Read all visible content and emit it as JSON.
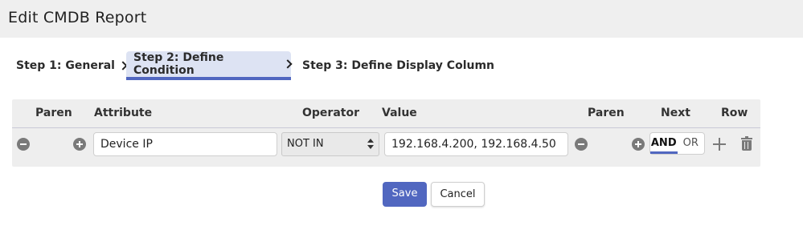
{
  "header": {
    "title": "Edit CMDB Report"
  },
  "steps": [
    {
      "label": "Step 1: General"
    },
    {
      "label": "Step 2: Define Condition",
      "active": true
    },
    {
      "label": "Step 3: Define Display Column"
    }
  ],
  "table": {
    "columns": [
      "Paren",
      "Attribute",
      "Operator",
      "Value",
      "Paren",
      "Next",
      "Row"
    ],
    "rows": [
      {
        "attribute": "Device IP",
        "operator": "NOT IN",
        "value": "192.168.4.200, 192.168.4.50",
        "next_options": [
          "AND",
          "OR"
        ],
        "next_selected": "AND"
      }
    ]
  },
  "buttons": {
    "save": "Save",
    "cancel": "Cancel"
  },
  "colors": {
    "accent": "#5167c0",
    "active_tab_bg": "#dde3f3",
    "panel_bg": "#eeeeee",
    "icon": "#7a7a7a"
  }
}
